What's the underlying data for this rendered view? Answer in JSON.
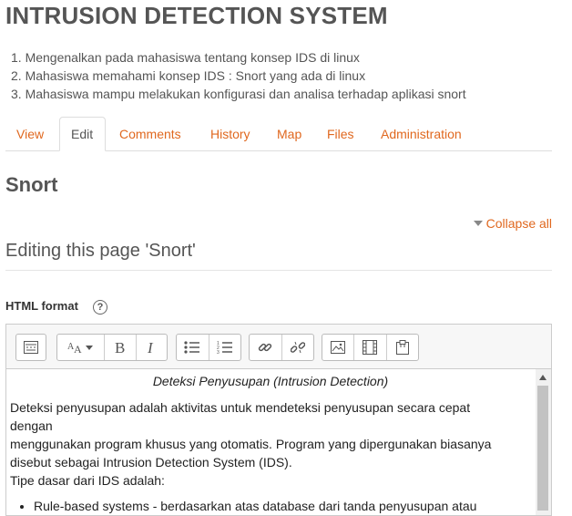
{
  "header": {
    "title": "INTRUSION DETECTION SYSTEM",
    "objectives": [
      "1. Mengenalkan pada mahasiswa tentang konsep IDS di linux",
      "2. Mahasiswa memahami konsep IDS : Snort yang ada di linux",
      "3. Mahasiswa mampu melakukan konfigurasi dan analisa terhadap aplikasi snort"
    ]
  },
  "tabs": [
    {
      "label": "View"
    },
    {
      "label": "Edit",
      "active": true
    },
    {
      "label": "Comments"
    },
    {
      "label": "History"
    },
    {
      "label": "Map"
    },
    {
      "label": "Files"
    },
    {
      "label": "Administration"
    }
  ],
  "page": {
    "title": "Snort",
    "collapse_all": "Collapse all",
    "editing_heading": "Editing this page 'Snort'",
    "format_label": "HTML format",
    "help_glyph": "?"
  },
  "toolbar": {
    "groups": [
      [
        "toolbar-toggle-icon"
      ],
      [
        "font-size-icon",
        "bold-icon",
        "italic-icon"
      ],
      [
        "bulleted-list-icon",
        "numbered-list-icon"
      ],
      [
        "link-icon",
        "unlink-icon"
      ],
      [
        "image-icon",
        "media-icon",
        "paste-icon"
      ]
    ]
  },
  "editor": {
    "caption": "Deteksi Penyusupan (Intrusion Detection)",
    "paragraph_lines": [
      "Deteksi penyusupan adalah aktivitas untuk mendeteksi penyusupan secara cepat",
      "dengan",
      "menggunakan program khusus yang otomatis. Program yang dipergunakan biasanya",
      "disebut sebagai Intrusion Detection System (IDS).",
      "Tipe dasar dari IDS adalah:"
    ],
    "bullets": [
      "Rule-based systems - berdasarkan atas database dari tanda penyusupan atau"
    ]
  },
  "colors": {
    "accent": "#e0681f",
    "title": "#555555",
    "toolbar_bg": "#f7f7f7"
  }
}
